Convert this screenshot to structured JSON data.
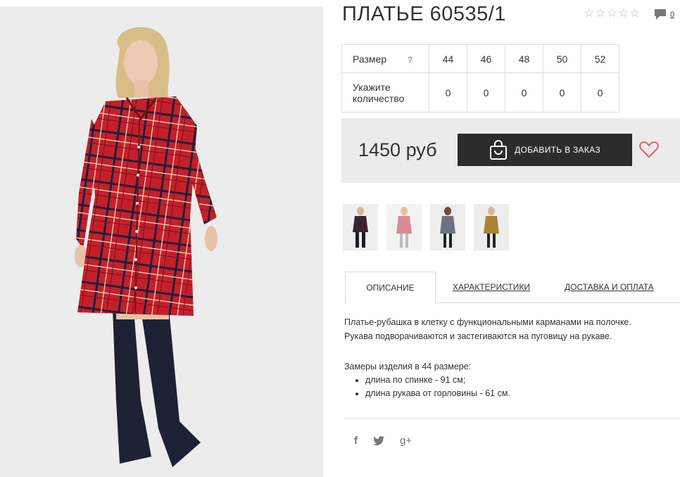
{
  "product": {
    "title": "ПЛАТЬЕ 60535/1",
    "rating_stars": 0,
    "rating_max": 5,
    "comments_count": "0"
  },
  "sizes_table": {
    "size_label": "Размер",
    "help_mark": "?",
    "qty_label": "Укажите количество",
    "sizes": [
      "44",
      "46",
      "48",
      "50",
      "52"
    ],
    "quantities": [
      "0",
      "0",
      "0",
      "0",
      "0"
    ]
  },
  "purchase": {
    "price": "1450 руб",
    "add_to_cart_label": "ДОБАВИТЬ В ЗАКАЗ"
  },
  "colors": {
    "button_bg": "#2c2c2c",
    "heart": "#e0606f",
    "price_bg": "#ebebeb"
  },
  "thumbnails": [
    {
      "name": "dark-plaid"
    },
    {
      "name": "pink"
    },
    {
      "name": "grey-pattern"
    },
    {
      "name": "leopard"
    }
  ],
  "tabs": [
    {
      "label": "ОПИСАНИЕ",
      "active": true
    },
    {
      "label": "ХАРАКТЕРИСТИКИ",
      "active": false
    },
    {
      "label": "ДОСТАВКА И ОПЛАТА",
      "active": false
    }
  ],
  "description": {
    "line1": "Платье-рубашка в клетку с функциональными карманами на полочке.",
    "line2": "Рукава подворачиваются и застегиваются на пуговицу на рукаве.",
    "measures_title": "Замеры изделия в 44 размере:",
    "measures": [
      "длина по спинке - 91 см;",
      "длина рукава от горловины - 61 см."
    ]
  },
  "social": {
    "facebook": "f",
    "twitter": "twitter-icon",
    "google": "g+"
  }
}
